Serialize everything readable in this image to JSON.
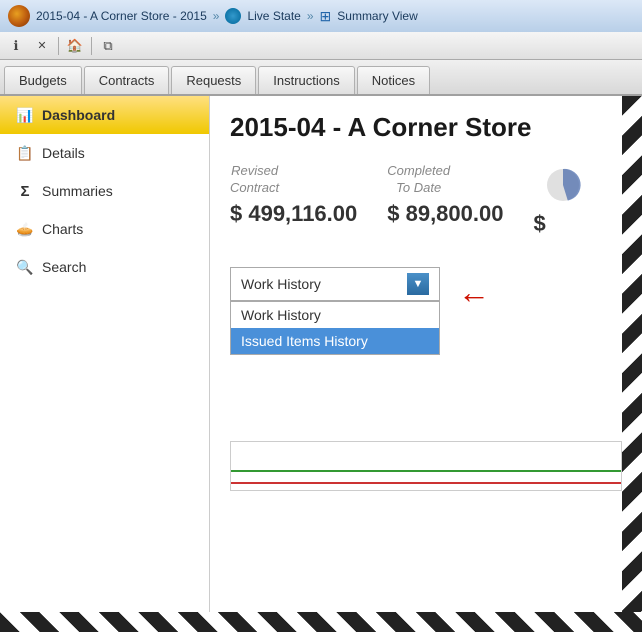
{
  "titlebar": {
    "app_title": "2015-04 - A Corner Store - 2015",
    "separator": "»",
    "live_state": "Live State",
    "separator2": "»",
    "summary_view": "Summary View"
  },
  "toolbar": {
    "info_btn": "ℹ",
    "close_btn": "✕",
    "home_btn": "⌂",
    "copy_btn": "⧉"
  },
  "nav": {
    "tabs": [
      {
        "id": "budgets",
        "label": "Budgets"
      },
      {
        "id": "contracts",
        "label": "Contracts"
      },
      {
        "id": "requests",
        "label": "Requests"
      },
      {
        "id": "instructions",
        "label": "Instructions"
      },
      {
        "id": "notices",
        "label": "Notices"
      }
    ]
  },
  "sidebar": {
    "items": [
      {
        "id": "dashboard",
        "label": "Dashboard",
        "icon": "📊",
        "active": true
      },
      {
        "id": "details",
        "label": "Details",
        "icon": "📋"
      },
      {
        "id": "summaries",
        "label": "Summaries",
        "icon": "Σ"
      },
      {
        "id": "charts",
        "label": "Charts",
        "icon": "🥧"
      },
      {
        "id": "search",
        "label": "Search",
        "icon": "🔍"
      }
    ]
  },
  "content": {
    "page_title": "2015-04 - A Corner Store",
    "stats": [
      {
        "label_line1": "Revised",
        "label_line2": "Contract",
        "value": "$ 499,116.00"
      },
      {
        "label_line1": "Completed",
        "label_line2": "To Date",
        "value": "$ 89,800.00"
      },
      {
        "label_line1": "",
        "label_line2": "",
        "value": "$"
      }
    ],
    "dropdown": {
      "selected": "Work History",
      "options": [
        {
          "label": "Work History",
          "id": "work-history"
        },
        {
          "label": "Issued Items History",
          "id": "issued-items",
          "highlighted": true
        }
      ]
    }
  }
}
